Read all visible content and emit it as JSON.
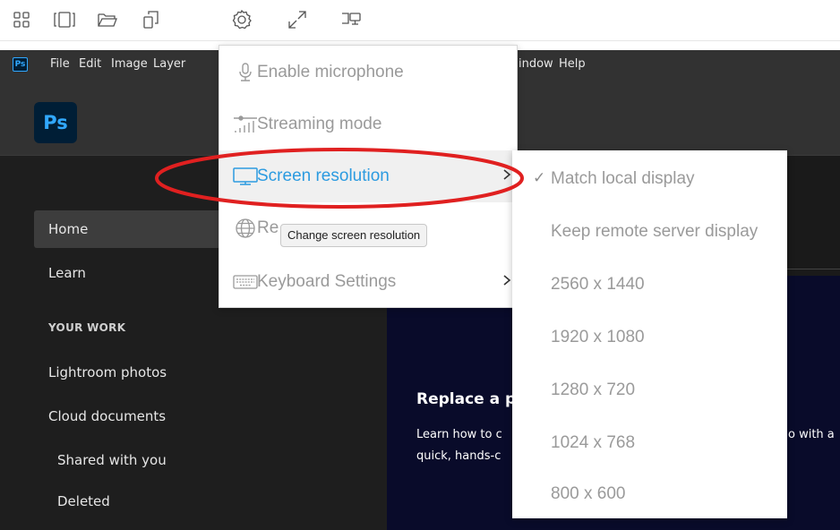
{
  "toolbar": {
    "icons": [
      "apps-grid-icon",
      "window-panels-icon",
      "folder-open-icon",
      "copy-files-icon",
      "gear-icon",
      "fullscreen-arrows-icon",
      "device-display-icon"
    ]
  },
  "menubar": {
    "app_badge": "Ps",
    "items": [
      "File",
      "Edit",
      "Image",
      "Layer",
      "Window",
      "Help"
    ],
    "window_visible": "indow"
  },
  "header": {
    "logo": "Ps"
  },
  "sidebar": {
    "home": "Home",
    "learn": "Learn",
    "section": "YOUR WORK",
    "lightroom": "Lightroom photos",
    "cloud": "Cloud documents",
    "shared": "Shared with you",
    "deleted": "Deleted"
  },
  "banner": {
    "title": "Replace a p",
    "line1_left": "Learn how to c",
    "line1_right": "o with a",
    "line2": "quick, hands-c"
  },
  "dropdown": {
    "microphone": "Enable microphone",
    "streaming": "Streaming mode",
    "resolution": "Screen resolution",
    "region": "Re",
    "keyboard": "Keyboard Settings"
  },
  "tooltip": "Change screen resolution",
  "submenu": {
    "items": [
      "Match local display",
      "Keep remote server display",
      "2560 x 1440",
      "1920 x 1080",
      "1280 x 720",
      "1024 x 768",
      "800 x 600"
    ],
    "checked": "Match local display",
    "check_mark": "✓"
  },
  "colors": {
    "annotation": "#e02020",
    "highlight_text": "#2c9be0",
    "ps_blue": "#31a8ff"
  }
}
